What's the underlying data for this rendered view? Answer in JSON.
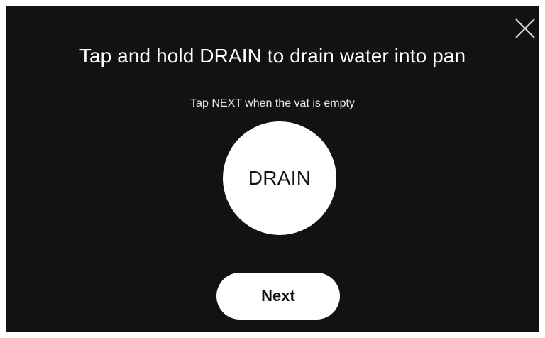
{
  "dialog": {
    "title": "Tap and hold DRAIN to drain water into pan",
    "subtitle": "Tap NEXT when the vat is empty"
  },
  "buttons": {
    "drain_label": "DRAIN",
    "next_label": "Next",
    "close_icon": "close-icon"
  },
  "colors": {
    "background": "#121214",
    "button_fill": "#ffffff",
    "text_light": "#ffffff",
    "text_dark": "#111111"
  }
}
